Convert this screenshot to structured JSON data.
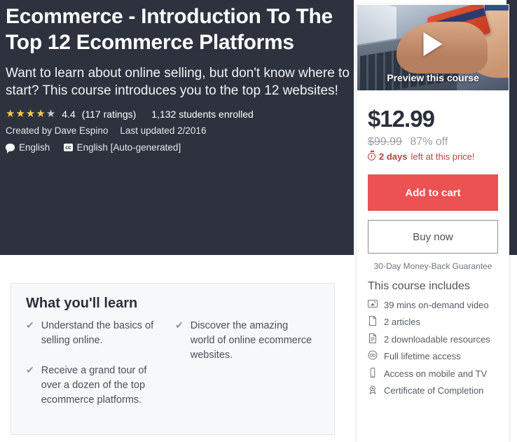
{
  "hero": {
    "title": "Ecommerce - Introduction To The Top 12 Ecommerce Platforms",
    "subtitle": "Want to learn about online selling, but don't know where to start? This course introduces you to the top 12 websites!",
    "rating": {
      "stars_filled": 4,
      "stars_total": 5,
      "value": "4.4",
      "count_label": "(117 ratings)",
      "star_color": "#f3ca48",
      "star_empty_color": "#c8cbd1"
    },
    "students_enrolled": "1,132 students enrolled",
    "created_by": "Created by Dave Espino",
    "last_updated": "Last updated 2/2016",
    "languages": [
      {
        "icon": "speech-bubble-icon",
        "label": "English"
      },
      {
        "icon": "closed-caption-icon",
        "badge": "cc",
        "label": "English [Auto-generated]"
      }
    ],
    "background_color": "#2d323e"
  },
  "learn": {
    "heading": "What you'll learn",
    "columns": [
      [
        "Understand the basics of selling online.",
        "Receive a grand tour of over a dozen of the top ecommerce platforms."
      ],
      [
        "Discover the amazing world of online ecommerce websites."
      ]
    ]
  },
  "buy_card": {
    "video": {
      "caption": "Preview this course",
      "play_icon": "play-icon"
    },
    "price": {
      "current": "$12.99",
      "original": "$99.99",
      "discount": "87% off",
      "timer_prefix": "2 days",
      "timer_suffix": "left at this price!",
      "timer_color": "#b5443c"
    },
    "add_to_cart_label": "Add to cart",
    "add_to_cart_color": "#ec5252",
    "buy_now_label": "Buy now",
    "guarantee": "30-Day Money-Back Guarantee",
    "includes_title": "This course includes",
    "includes": [
      {
        "icon": "video-icon",
        "label": "39 mins on-demand video"
      },
      {
        "icon": "article-icon",
        "label": "2 articles"
      },
      {
        "icon": "download-file-icon",
        "label": "2 downloadable resources"
      },
      {
        "icon": "infinity-icon",
        "label": "Full lifetime access"
      },
      {
        "icon": "mobile-icon",
        "label": "Access on mobile and TV"
      },
      {
        "icon": "trophy-icon",
        "label": "Certificate of Completion"
      }
    ]
  }
}
